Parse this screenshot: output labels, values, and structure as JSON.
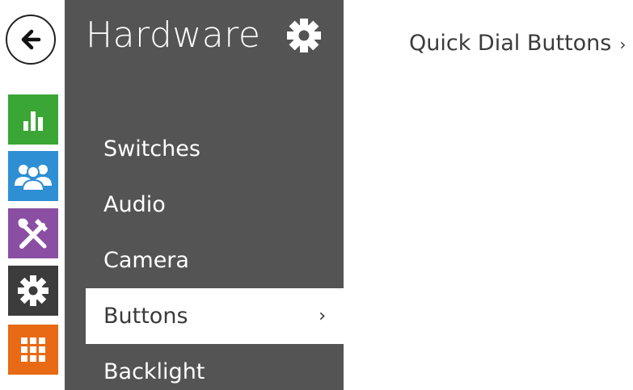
{
  "sidebar": {
    "back_icon": "arrow-left-icon",
    "icons": [
      {
        "name": "status-icon",
        "color": "#3aa635"
      },
      {
        "name": "directory-icon",
        "color": "#2f8fd4"
      },
      {
        "name": "hardware-tools-icon",
        "color": "#8a4fa3"
      },
      {
        "name": "services-gear-icon",
        "color": "#3c3c3c"
      },
      {
        "name": "system-grid-icon",
        "color": "#e86a14"
      }
    ]
  },
  "panel": {
    "title": "Hardware",
    "settings_icon": "gear-icon",
    "background": "#545454",
    "items": [
      {
        "label": "Switches"
      },
      {
        "label": "Audio"
      },
      {
        "label": "Camera"
      },
      {
        "label": "Buttons",
        "chevron": "›",
        "active": true
      },
      {
        "label": "Backlight"
      }
    ]
  },
  "main": {
    "submenu_link": "Quick Dial Buttons",
    "submenu_chevron": "›"
  }
}
